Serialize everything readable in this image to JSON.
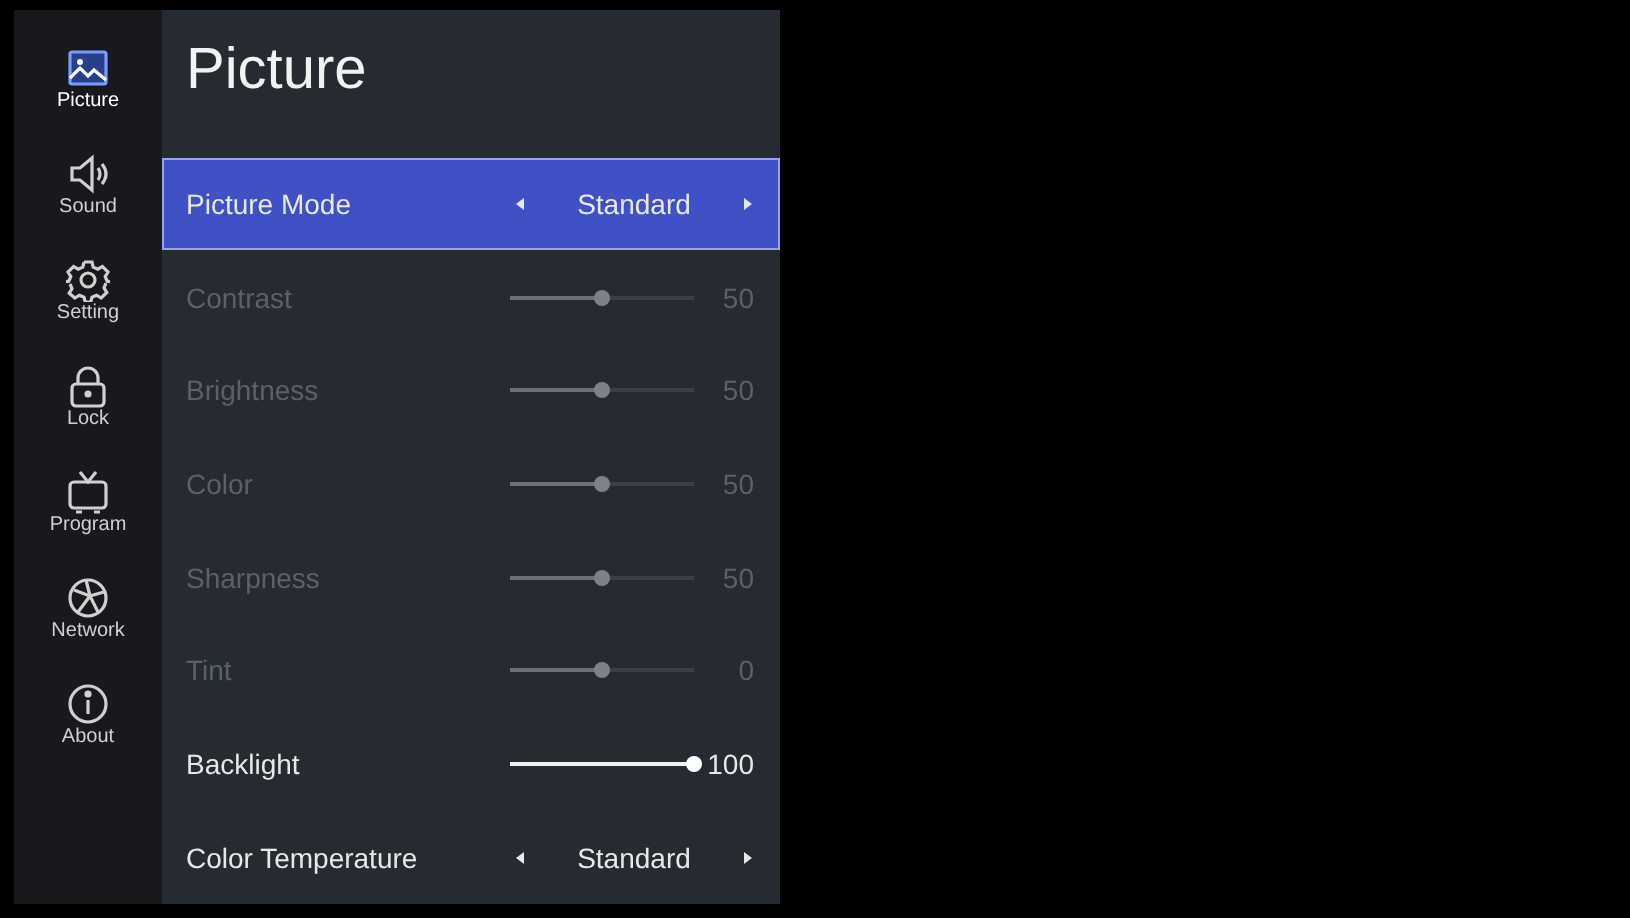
{
  "sidebar": {
    "items": [
      {
        "label": "Picture",
        "selected": true
      },
      {
        "label": "Sound",
        "selected": false
      },
      {
        "label": "Setting",
        "selected": false
      },
      {
        "label": "Lock",
        "selected": false
      },
      {
        "label": "Program",
        "selected": false
      },
      {
        "label": "Network",
        "selected": false
      },
      {
        "label": "About",
        "selected": false
      }
    ]
  },
  "panel": {
    "title": "Picture",
    "rows": [
      {
        "kind": "select",
        "label": "Picture Mode",
        "value": "Standard",
        "selected": true,
        "disabled": false
      },
      {
        "kind": "slider",
        "label": "Contrast",
        "value": "50",
        "level": 0.5,
        "selected": false,
        "disabled": true
      },
      {
        "kind": "slider",
        "label": "Brightness",
        "value": "50",
        "level": 0.5,
        "selected": false,
        "disabled": true
      },
      {
        "kind": "slider",
        "label": "Color",
        "value": "50",
        "level": 0.5,
        "selected": false,
        "disabled": true
      },
      {
        "kind": "slider",
        "label": "Sharpness",
        "value": "50",
        "level": 0.5,
        "selected": false,
        "disabled": true
      },
      {
        "kind": "slider",
        "label": "Tint",
        "value": "0",
        "level": 0.5,
        "selected": false,
        "disabled": true
      },
      {
        "kind": "slider",
        "label": "Backlight",
        "value": "100",
        "level": 1,
        "selected": false,
        "disabled": false
      },
      {
        "kind": "select",
        "label": "Color Temperature",
        "value": "Standard",
        "selected": false,
        "disabled": false
      }
    ]
  }
}
